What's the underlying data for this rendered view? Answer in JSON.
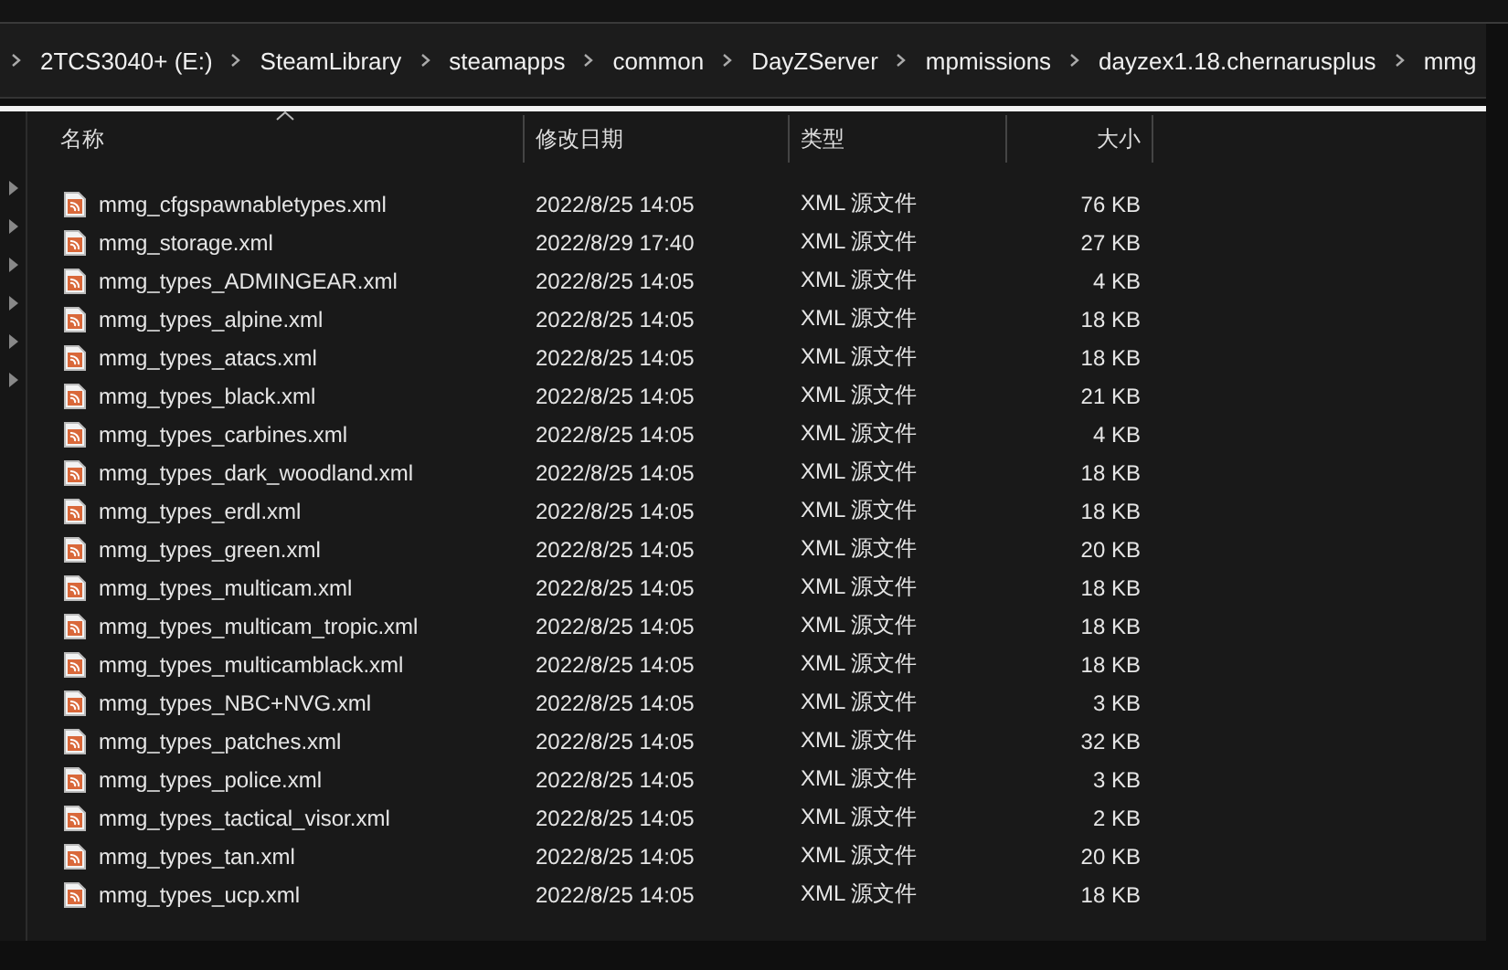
{
  "breadcrumb": [
    "2TCS3040+ (E:)",
    "SteamLibrary",
    "steamapps",
    "common",
    "DayZServer",
    "mpmissions",
    "dayzex1.18.chernarusplus",
    "mmg"
  ],
  "columns": [
    {
      "label": "名称",
      "sorted": true
    },
    {
      "label": "修改日期",
      "sorted": false
    },
    {
      "label": "类型",
      "sorted": false
    },
    {
      "label": "大小",
      "sorted": false
    }
  ],
  "files": [
    {
      "name": "mmg_cfgspawnabletypes.xml",
      "modified": "2022/8/25 14:05",
      "type": "XML 源文件",
      "size": "76 KB"
    },
    {
      "name": "mmg_storage.xml",
      "modified": "2022/8/29 17:40",
      "type": "XML 源文件",
      "size": "27 KB"
    },
    {
      "name": "mmg_types_ADMINGEAR.xml",
      "modified": "2022/8/25 14:05",
      "type": "XML 源文件",
      "size": "4 KB"
    },
    {
      "name": "mmg_types_alpine.xml",
      "modified": "2022/8/25 14:05",
      "type": "XML 源文件",
      "size": "18 KB"
    },
    {
      "name": "mmg_types_atacs.xml",
      "modified": "2022/8/25 14:05",
      "type": "XML 源文件",
      "size": "18 KB"
    },
    {
      "name": "mmg_types_black.xml",
      "modified": "2022/8/25 14:05",
      "type": "XML 源文件",
      "size": "21 KB"
    },
    {
      "name": "mmg_types_carbines.xml",
      "modified": "2022/8/25 14:05",
      "type": "XML 源文件",
      "size": "4 KB"
    },
    {
      "name": "mmg_types_dark_woodland.xml",
      "modified": "2022/8/25 14:05",
      "type": "XML 源文件",
      "size": "18 KB"
    },
    {
      "name": "mmg_types_erdl.xml",
      "modified": "2022/8/25 14:05",
      "type": "XML 源文件",
      "size": "18 KB"
    },
    {
      "name": "mmg_types_green.xml",
      "modified": "2022/8/25 14:05",
      "type": "XML 源文件",
      "size": "20 KB"
    },
    {
      "name": "mmg_types_multicam.xml",
      "modified": "2022/8/25 14:05",
      "type": "XML 源文件",
      "size": "18 KB"
    },
    {
      "name": "mmg_types_multicam_tropic.xml",
      "modified": "2022/8/25 14:05",
      "type": "XML 源文件",
      "size": "18 KB"
    },
    {
      "name": "mmg_types_multicamblack.xml",
      "modified": "2022/8/25 14:05",
      "type": "XML 源文件",
      "size": "18 KB"
    },
    {
      "name": "mmg_types_NBC+NVG.xml",
      "modified": "2022/8/25 14:05",
      "type": "XML 源文件",
      "size": "3 KB"
    },
    {
      "name": "mmg_types_patches.xml",
      "modified": "2022/8/25 14:05",
      "type": "XML 源文件",
      "size": "32 KB"
    },
    {
      "name": "mmg_types_police.xml",
      "modified": "2022/8/25 14:05",
      "type": "XML 源文件",
      "size": "3 KB"
    },
    {
      "name": "mmg_types_tactical_visor.xml",
      "modified": "2022/8/25 14:05",
      "type": "XML 源文件",
      "size": "2 KB"
    },
    {
      "name": "mmg_types_tan.xml",
      "modified": "2022/8/25 14:05",
      "type": "XML 源文件",
      "size": "20 KB"
    },
    {
      "name": "mmg_types_ucp.xml",
      "modified": "2022/8/25 14:05",
      "type": "XML 源文件",
      "size": "18 KB"
    }
  ]
}
